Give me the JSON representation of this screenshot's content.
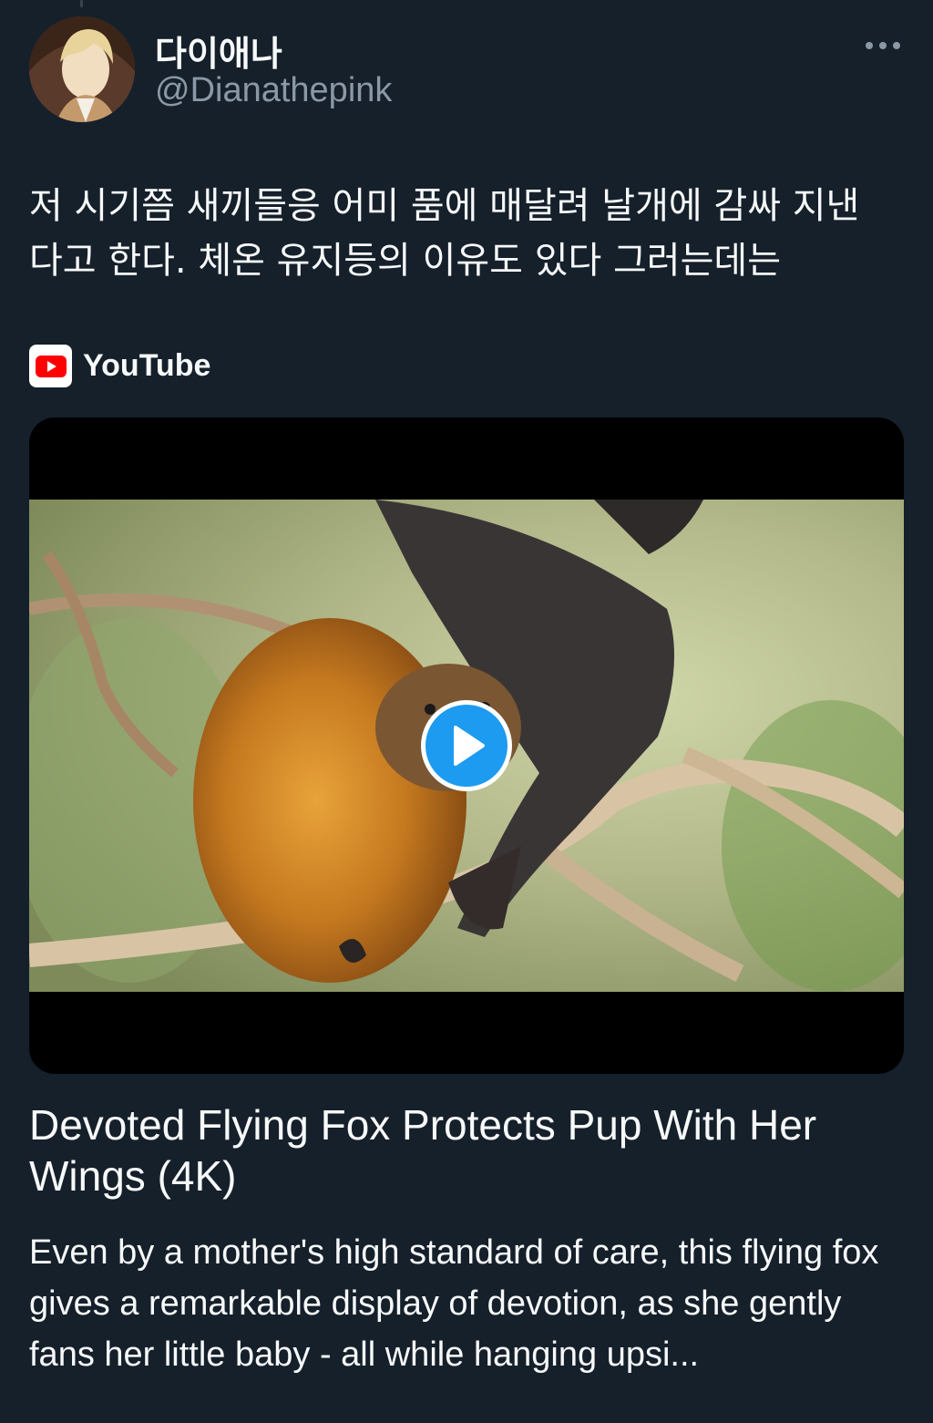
{
  "author": {
    "display_name": "다이애나",
    "handle": "@Dianathepink"
  },
  "tweet": {
    "text": "저 시기쯤 새끼들응 어미 품에 매달려 날개에 감싸 지낸\n다고 한다. 체온 유지등의 이유도 있다 그러는데는"
  },
  "card": {
    "source": "YouTube",
    "title": "Devoted Flying Fox Protects Pup With Her Wings (4K)",
    "description": "Even by a mother's high standard of care, this flying fox gives a remarkable display of devotion, as she gently fans her little baby - all while hanging upsi..."
  },
  "icons": {
    "more": "more-horizontal-icon",
    "source": "youtube-icon",
    "play": "play-icon"
  },
  "colors": {
    "background": "#15202b",
    "accent": "#1d9bf0",
    "secondary_text": "#8b98a5",
    "youtube_red": "#ff0000"
  }
}
